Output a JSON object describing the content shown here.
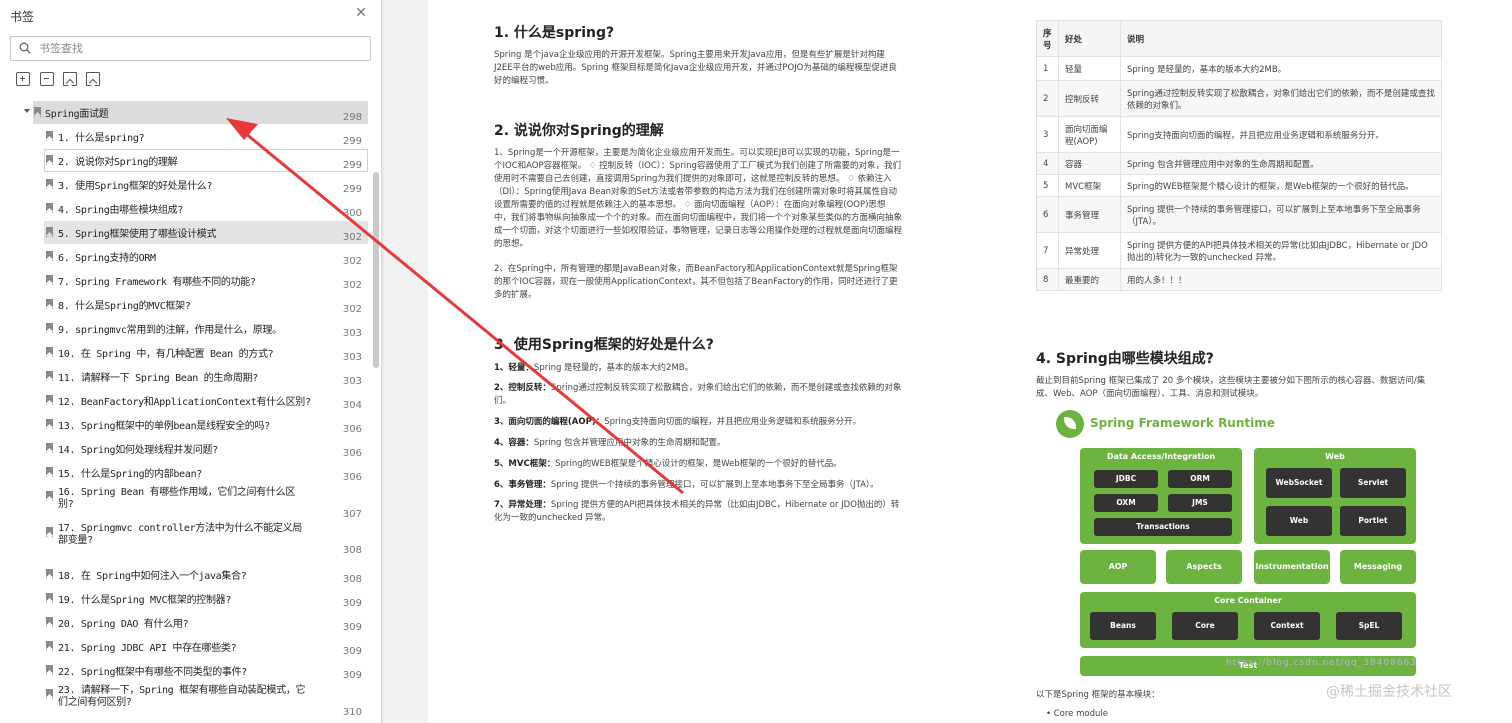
{
  "sidebar": {
    "title": "书签",
    "search_placeholder": "书签查找",
    "root": {
      "label": "Spring面试题",
      "page": "298"
    },
    "items": [
      {
        "label": "1. 什么是spring?",
        "page": "299"
      },
      {
        "label": "2. 说说你对Spring的理解",
        "page": "299"
      },
      {
        "label": "3. 使用Spring框架的好处是什么?",
        "page": "299"
      },
      {
        "label": "4. Spring由哪些模块组成?",
        "page": "300"
      },
      {
        "label": "5. Spring框架使用了哪些设计模式",
        "page": "302"
      },
      {
        "label": "6. Spring支持的ORM",
        "page": "302"
      },
      {
        "label": "7. Spring Framework 有哪些不同的功能?",
        "page": "302"
      },
      {
        "label": "8. 什么是Spring的MVC框架?",
        "page": "302"
      },
      {
        "label": "9. springmvc常用到的注解，作用是什么，原理。",
        "page": "303"
      },
      {
        "label": "10. 在 Spring 中，有几种配置 Bean 的方式?",
        "page": "303"
      },
      {
        "label": "11. 请解释一下 Spring Bean 的生命周期?",
        "page": "303"
      },
      {
        "label": "12. BeanFactory和ApplicationContext有什么区别?",
        "page": "304"
      },
      {
        "label": "13. Spring框架中的单例bean是线程安全的吗?",
        "page": "306"
      },
      {
        "label": "14. Spring如何处理线程并发问题?",
        "page": "306"
      },
      {
        "label": "15. 什么是Spring的内部bean?",
        "page": "306"
      },
      {
        "label": "16. Spring Bean 有哪些作用域，它们之间有什么区别?",
        "page": "307"
      },
      {
        "label": "17. Springmvc controller方法中为什么不能定义局部变量?",
        "page": "308"
      },
      {
        "label": "18. 在 Spring中如何注入一个java集合?",
        "page": "308"
      },
      {
        "label": "19. 什么是Spring MVC框架的控制器?",
        "page": "309"
      },
      {
        "label": "20. Spring DAO 有什么用?",
        "page": "309"
      },
      {
        "label": "21. Spring JDBC API 中存在哪些类?",
        "page": "309"
      },
      {
        "label": "22. Spring框架中有哪些不同类型的事件?",
        "page": "309"
      },
      {
        "label": "23. 请解释一下，Spring 框架有哪些自动装配模式，它们之间有何区别?",
        "page": "310"
      }
    ]
  },
  "doc": {
    "s1": {
      "title": "1. 什么是spring?",
      "body": "Spring 是个java企业级应用的开源开发框架。Spring主要用来开发Java应用，但是有些扩展是针对构建J2EE平台的web应用。Spring 框架目标是简化Java企业级应用开发，并通过POJO为基础的编程模型促进良好的编程习惯。"
    },
    "s2": {
      "title": "2. 说说你对Spring的理解",
      "p1": "1、Spring是一个开源框架，主要是为简化企业级应用开发而生。可以实现EJB可以实现的功能，Spring是一个IOC和AOP容器框架。 ♢ 控制反转（IOC）：Spring容器使用了工厂模式为我们创建了所需要的对象，我们使用时不需要自己去创建，直接调用Spring为我们提供的对象即可，这就是控制反转的思想。 ♢ 依赖注入（DI）：Spring使用Java Bean对象的Set方法或者带参数的构造方法为我们在创建所需对象时将其属性自动设置所需要的值的过程就是依赖注入的基本思想。 ♢ 面向切面编程（AOP）：在面向对象编程(OOP)思想中，我们将事物纵向抽象成一个个的对象。而在面向切面编程中，我们将一个个对象某些类似的方面横向抽象成一个切面，对这个切面进行一些如权限验证，事物管理，记录日志等公用操作处理的过程就是面向切面编程的思想。",
      "p2": "2、在Spring中，所有管理的都是JavaBean对象，而BeanFactory和ApplicationContext就是Spring框架的那个IOC容器，现在一般使用ApplicationContext，其不但包括了BeanFactory的作用，同时还进行了更多的扩展。"
    },
    "s3": {
      "title": "3. 使用Spring框架的好处是什么?",
      "items": [
        {
          "k": "1、轻量：",
          "v": "Spring 是轻量的，基本的版本大约2MB。"
        },
        {
          "k": "2、控制反转：",
          "v": "Spring通过控制反转实现了松散耦合，对象们给出它们的依赖，而不是创建或查找依赖的对象们。"
        },
        {
          "k": "3、面向切面的编程(AOP)：",
          "v": "Spring支持面向切面的编程，并且把应用业务逻辑和系统服务分开。"
        },
        {
          "k": "4、容器：",
          "v": "Spring 包含并管理应用中对象的生命周期和配置。"
        },
        {
          "k": "5、MVC框架：",
          "v": "Spring的WEB框架是个精心设计的框架，是Web框架的一个很好的替代品。"
        },
        {
          "k": "6、事务管理：",
          "v": "Spring 提供一个持续的事务管理接口，可以扩展到上至本地事务下至全局事务（JTA）。"
        },
        {
          "k": "7、异常处理：",
          "v": "Spring 提供方便的API把具体技术相关的异常（比如由JDBC，Hibernate or JDO抛出的）转化为一致的unchecked 异常。"
        }
      ]
    },
    "table": {
      "headers": [
        "序号",
        "好处",
        "说明"
      ],
      "rows": [
        [
          "1",
          "轻量",
          "Spring 是轻量的，基本的版本大约2MB。"
        ],
        [
          "2",
          "控制反转",
          "Spring通过控制反转实现了松散耦合，对象们给出它们的依赖，而不是创建或查找依赖的对象们。"
        ],
        [
          "3",
          "面向切面编程(AOP)",
          "Spring支持面向切面的编程，并且把应用业务逻辑和系统服务分开。"
        ],
        [
          "4",
          "容器",
          "Spring 包含并管理应用中对象的生命周期和配置。"
        ],
        [
          "5",
          "MVC框架",
          "Spring的WEB框架是个精心设计的框架，是Web框架的一个很好的替代品。"
        ],
        [
          "6",
          "事务管理",
          "Spring 提供一个持续的事务管理接口，可以扩展到上至本地事务下至全局事务（JTA）。"
        ],
        [
          "7",
          "异常处理",
          "Spring 提供方便的API把具体技术相关的异常(比如由JDBC，Hibernate or JDO抛出的)转化为一致的unchecked 异常。"
        ],
        [
          "8",
          "最重要的",
          "用的人多！！！"
        ]
      ]
    },
    "s4": {
      "title": "4. Spring由哪些模块组成?",
      "body": "截止到目前Spring 框架已集成了 20 多个模块，这些模块主要被分如下图所示的核心容器、数据访问/集成、Web、AOP（面向切面编程）、工具、消息和测试模块。",
      "below": "以下是Spring 框架的基本模块：",
      "bullet": "• Core module"
    },
    "diagram": {
      "title": "Spring Framework Runtime",
      "data_access": {
        "label": "Data Access/Integration",
        "boxes": [
          "JDBC",
          "ORM",
          "OXM",
          "JMS",
          "Transactions"
        ]
      },
      "web": {
        "label": "Web",
        "boxes": [
          "WebSocket",
          "Servlet",
          "Web",
          "Portlet"
        ]
      },
      "middle": [
        "AOP",
        "Aspects",
        "Instrumentation",
        "Messaging"
      ],
      "core": {
        "label": "Core Container",
        "boxes": [
          "Beans",
          "Core",
          "Context",
          "SpEL"
        ]
      },
      "test": "Test",
      "watermark": "https://blog.csdn.net/qq_38408663"
    },
    "credit": "@稀土掘金技术社区"
  },
  "colors": {
    "spring_green": "#6db33f",
    "annotation_arrow": "#e8393a"
  }
}
